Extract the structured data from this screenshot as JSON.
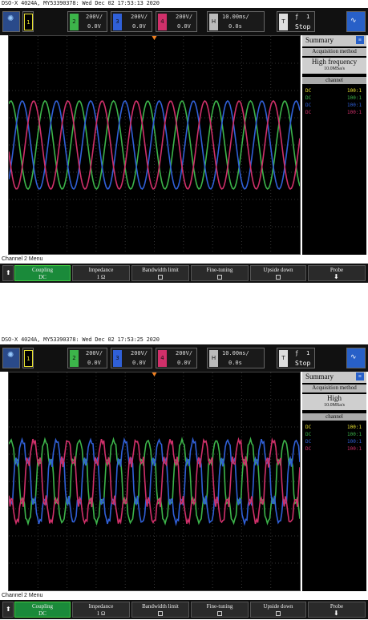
{
  "screens": [
    {
      "title_line": "DSO-X 4024A, MY53390378: Wed Dec 02 17:53:13 2020",
      "channels": [
        {
          "num": "1",
          "scale": "",
          "offset": "",
          "color": "#e8e030"
        },
        {
          "num": "2",
          "scale": "200V/",
          "offset": "0.0V",
          "color": "#3cb44a"
        },
        {
          "num": "3",
          "scale": "200V/",
          "offset": "0.0V",
          "color": "#3060d8"
        },
        {
          "num": "4",
          "scale": "200V/",
          "offset": "0.0V",
          "color": "#d0306a"
        }
      ],
      "horizontal": {
        "label": "H",
        "scale": "10.00ms/",
        "delay": "0.0s"
      },
      "trigger": {
        "label": "T",
        "symbol": "ƒ",
        "level": "1",
        "state": "Stop"
      },
      "summary": {
        "title": "Summary",
        "acq_label": "Acquisition method",
        "mode": "High frequency",
        "rate": "10.0MSa/s",
        "channel_label": "channel",
        "rows": [
          {
            "coupling": "DC",
            "ratio": "100:1",
            "color": "#e8e030"
          },
          {
            "coupling": "DC",
            "ratio": "100:1",
            "color": "#3cb44a"
          },
          {
            "coupling": "DC",
            "ratio": "100:1",
            "color": "#3060d8"
          },
          {
            "coupling": "DC",
            "ratio": "100:1",
            "color": "#d0306a"
          }
        ]
      },
      "menu_title": "Channel 2 Menu",
      "softkeys": [
        {
          "label": "Coupling",
          "sub": "DC"
        },
        {
          "label": "Impedance",
          "sub": "1 Ω"
        },
        {
          "label": "Bandwidth limit",
          "sub": ""
        },
        {
          "label": "Fine-tuning",
          "sub": ""
        },
        {
          "label": "Upside down",
          "sub": ""
        },
        {
          "label": "Probe",
          "sub": ""
        }
      ]
    },
    {
      "title_line": "DSO-X 4024A, MY53390378: Wed Dec 02 17:53:25 2020",
      "channels": [
        {
          "num": "1",
          "scale": "",
          "offset": "",
          "color": "#e8e030"
        },
        {
          "num": "2",
          "scale": "200V/",
          "offset": "0.0V",
          "color": "#3cb44a"
        },
        {
          "num": "3",
          "scale": "200V/",
          "offset": "0.0V",
          "color": "#3060d8"
        },
        {
          "num": "4",
          "scale": "200V/",
          "offset": "0.0V",
          "color": "#d0306a"
        }
      ],
      "horizontal": {
        "label": "H",
        "scale": "10.00ms/",
        "delay": "0.0s"
      },
      "trigger": {
        "label": "T",
        "symbol": "ƒ",
        "level": "1",
        "state": "Stop"
      },
      "summary": {
        "title": "Summary",
        "acq_label": "Acquisition method",
        "mode": "High",
        "rate": "10.0MSa/s",
        "channel_label": "channel",
        "rows": [
          {
            "coupling": "DC",
            "ratio": "100:1",
            "color": "#e8e030"
          },
          {
            "coupling": "DC",
            "ratio": "100:1",
            "color": "#3cb44a"
          },
          {
            "coupling": "DC",
            "ratio": "100:1",
            "color": "#3060d8"
          },
          {
            "coupling": "DC",
            "ratio": "100:1",
            "color": "#d0306a"
          }
        ]
      },
      "menu_title": "Channel 2 Menu",
      "softkeys": [
        {
          "label": "Coupling",
          "sub": "DC"
        },
        {
          "label": "Impedance",
          "sub": "1 Ω"
        },
        {
          "label": "Bandwidth limit",
          "sub": ""
        },
        {
          "label": "Fine-tuning",
          "sub": ""
        },
        {
          "label": "Upside down",
          "sub": ""
        },
        {
          "label": "Probe",
          "sub": ""
        }
      ]
    }
  ]
}
